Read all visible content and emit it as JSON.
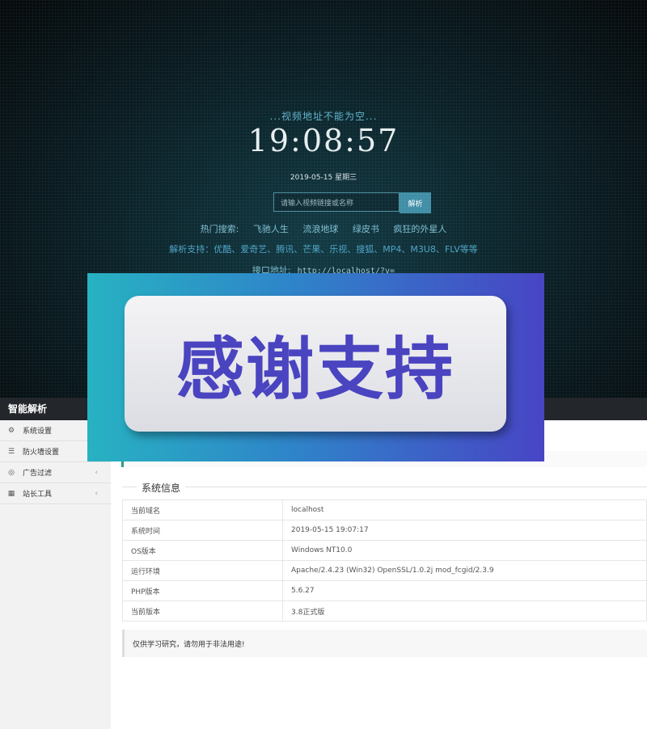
{
  "hero": {
    "message": "...视频地址不能为空...",
    "clock": "19:08:57",
    "date": "2019-05-15 星期三",
    "search_placeholder": "请输入视频链接或名称",
    "search_button": "解析",
    "hot_label": "热门搜索:",
    "hot_items": [
      "飞驰人生",
      "流浪地球",
      "绿皮书",
      "疯狂的外星人"
    ],
    "support_text": "解析支持：优酷、爱奇艺、腾讯、芒果、乐视、搜狐、MP4、M3U8、FLV等等",
    "api_label": "接口地址:",
    "api_url": "http://localhost/?v="
  },
  "admin": {
    "brand": "智能解析",
    "sidebar": [
      {
        "label": "系统设置",
        "icon": "gear-icon"
      },
      {
        "label": "防火墙设置",
        "icon": "list-icon"
      },
      {
        "label": "广告过滤",
        "icon": "check-circle-icon",
        "has_chevron": true
      },
      {
        "label": "站长工具",
        "icon": "grid-icon",
        "has_chevron": true
      }
    ],
    "system_info_title": "系统信息",
    "system_info": [
      {
        "key": "当前域名",
        "value": "localhost"
      },
      {
        "key": "系统时间",
        "value": "2019-05-15 19:07:17"
      },
      {
        "key": "OS版本",
        "value": "Windows NT10.0"
      },
      {
        "key": "运行环境",
        "value": "Apache/2.4.23 (Win32) OpenSSL/1.0.2j mod_fcgid/2.3.9"
      },
      {
        "key": "PHP版本",
        "value": "5.6.27"
      },
      {
        "key": "当前版本",
        "value": "3.8正式版"
      }
    ],
    "warning": "仅供学习研究，请勿用于非法用途!"
  },
  "banner": {
    "text": "感谢支持"
  },
  "colors": {
    "accent": "#3f8ea6",
    "banner_text": "#4a44c0"
  }
}
